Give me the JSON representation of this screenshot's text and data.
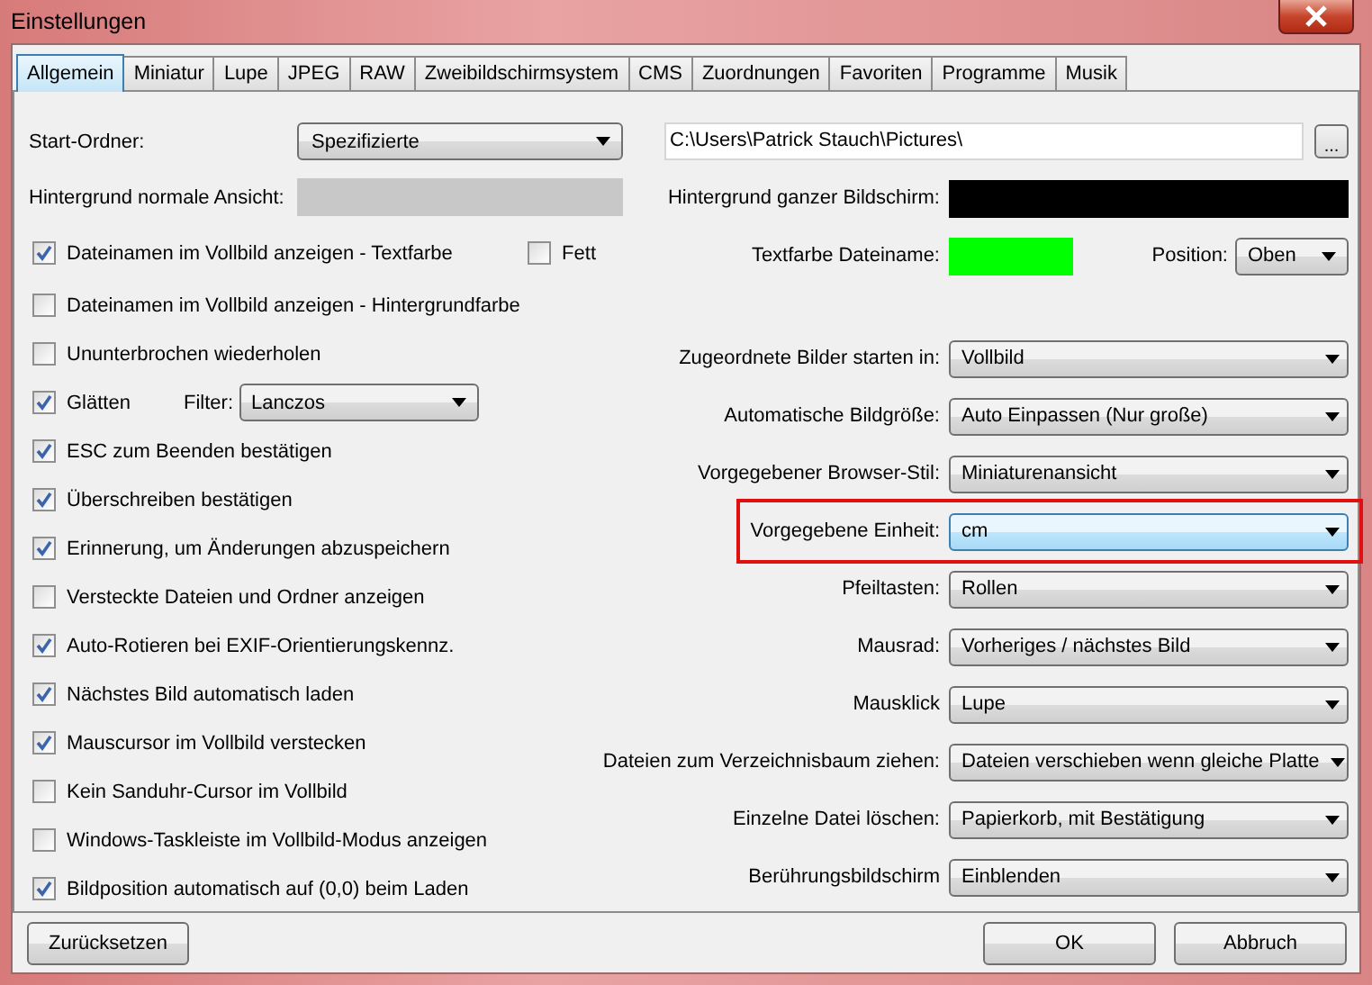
{
  "window": {
    "title": "Einstellungen"
  },
  "tabs": [
    {
      "label": "Allgemein",
      "selected": true
    },
    {
      "label": "Miniatur",
      "selected": false
    },
    {
      "label": "Lupe",
      "selected": false
    },
    {
      "label": "JPEG",
      "selected": false
    },
    {
      "label": "RAW",
      "selected": false
    },
    {
      "label": "Zweibildschirmsystem",
      "selected": false
    },
    {
      "label": "CMS",
      "selected": false
    },
    {
      "label": "Zuordnungen",
      "selected": false
    },
    {
      "label": "Favoriten",
      "selected": false
    },
    {
      "label": "Programme",
      "selected": false
    },
    {
      "label": "Musik",
      "selected": false
    }
  ],
  "left_rows": [
    {
      "kind": "select",
      "label": "Start-Ordner:",
      "value": "Spezifizierte"
    },
    {
      "kind": "color",
      "label": "Hintergrund normale Ansicht:",
      "color": "#c8c8c8"
    },
    {
      "kind": "checkbox",
      "label": "Dateinamen im Vollbild anzeigen - Textfarbe",
      "checked": true,
      "extra": {
        "label": "Fett",
        "checked": false
      }
    },
    {
      "kind": "checkbox",
      "label": "Dateinamen im Vollbild anzeigen - Hintergrundfarbe",
      "checked": false
    },
    {
      "kind": "checkbox",
      "label": "Ununterbrochen wiederholen",
      "checked": false
    },
    {
      "kind": "checkbox",
      "label": "Glätten",
      "checked": true,
      "filter": {
        "label": "Filter:",
        "value": "Lanczos"
      }
    },
    {
      "kind": "checkbox",
      "label": "ESC zum Beenden bestätigen",
      "checked": true
    },
    {
      "kind": "checkbox",
      "label": "Überschreiben bestätigen",
      "checked": true
    },
    {
      "kind": "checkbox",
      "label": "Erinnerung, um Änderungen abzuspeichern",
      "checked": true
    },
    {
      "kind": "checkbox",
      "label": "Versteckte Dateien und Ordner anzeigen",
      "checked": false
    },
    {
      "kind": "checkbox",
      "label": "Auto-Rotieren bei EXIF-Orientierungskennz.",
      "checked": true
    },
    {
      "kind": "checkbox",
      "label": "Nächstes Bild automatisch laden",
      "checked": true
    },
    {
      "kind": "checkbox",
      "label": "Mauscursor im Vollbild verstecken",
      "checked": true
    },
    {
      "kind": "checkbox",
      "label": "Kein Sanduhr-Cursor im Vollbild",
      "checked": false
    },
    {
      "kind": "checkbox",
      "label": "Windows-Taskleiste im Vollbild-Modus anzeigen",
      "checked": false
    },
    {
      "kind": "checkbox",
      "label": "Bildposition automatisch auf (0,0) beim Laden",
      "checked": true
    }
  ],
  "folder_path": {
    "value": "C:\\Users\\Patrick Stauch\\Pictures\\",
    "browse": "..."
  },
  "color_rows": [
    {
      "label": "Hintergrund ganzer Bildschirm:",
      "color": "#000000"
    },
    {
      "label": "Textfarbe Dateiname:",
      "color": "#00ff00",
      "position": {
        "label": "Position:",
        "value": "Oben"
      }
    }
  ],
  "right_selects": [
    {
      "label": "Zugeordnete Bilder starten in:",
      "value": "Vollbild",
      "highlighted": false
    },
    {
      "label": "Automatische Bildgröße:",
      "value": "Auto Einpassen (Nur große)",
      "highlighted": false
    },
    {
      "label": "Vorgegebener Browser-Stil:",
      "value": "Miniaturenansicht",
      "highlighted": false
    },
    {
      "label": "Vorgegebene Einheit:",
      "value": "cm",
      "highlighted": true
    },
    {
      "label": "Pfeiltasten:",
      "value": "Rollen",
      "highlighted": false
    },
    {
      "label": "Mausrad:",
      "value": "Vorheriges / nächstes Bild",
      "highlighted": false
    },
    {
      "label": "Mausklick",
      "value": "Lupe",
      "highlighted": false
    },
    {
      "label": "Dateien zum Verzeichnisbaum ziehen:",
      "value": "Dateien verschieben wenn gleiche Platte",
      "highlighted": false
    },
    {
      "label": "Einzelne Datei löschen:",
      "value": "Papierkorb, mit Bestätigung",
      "highlighted": false
    },
    {
      "label": "Berührungsbildschirm",
      "value": "Einblenden",
      "highlighted": false
    }
  ],
  "buttons": {
    "reset": "Zurücksetzen",
    "ok": "OK",
    "cancel": "Abbruch"
  }
}
